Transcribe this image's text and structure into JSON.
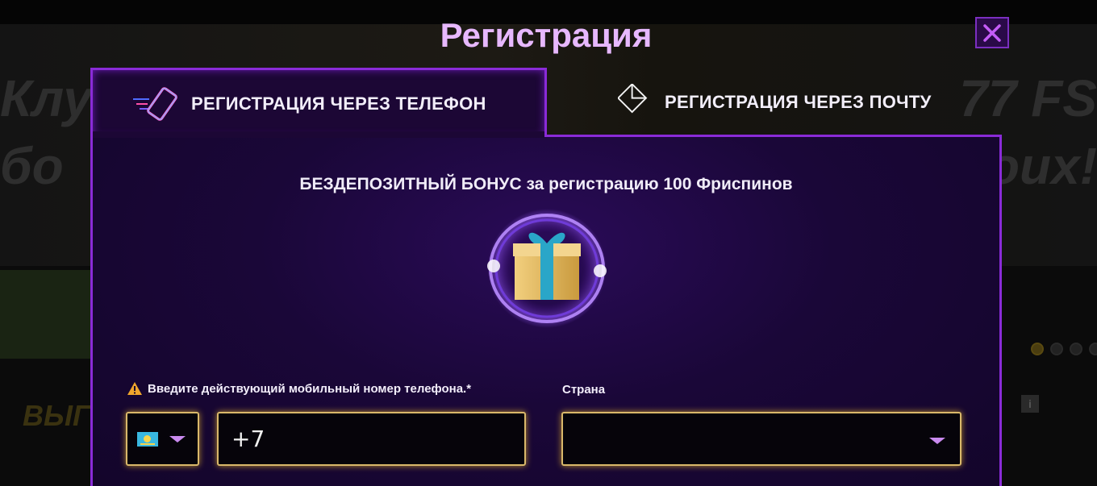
{
  "modal": {
    "title": "Регистрация",
    "tabs": [
      {
        "label": "РЕГИСТРАЦИЯ ЧЕРЕЗ ТЕЛЕФОН",
        "icon": "phone-icon",
        "active": true
      },
      {
        "label": "РЕГИСТРАЦИЯ ЧЕРЕЗ ПОЧТУ",
        "icon": "envelope-icon",
        "active": false
      }
    ],
    "bonus_text": "БЕЗДЕПОЗИТНЫЙ БОНУС за регистрацию 100 Фриспинов",
    "phone_label": "Введите действующий мобильный номер телефона.*",
    "phone_value": "+7",
    "country_label": "Страна",
    "country_value": "",
    "colors": {
      "accent": "#8a2bd8",
      "title": "#e7b8ff",
      "field_border": "#d9b86a"
    }
  },
  "background": {
    "text_left": "Клу\nбо",
    "text_right": "77 FS\noux!",
    "button_text": "ВЫГ"
  }
}
